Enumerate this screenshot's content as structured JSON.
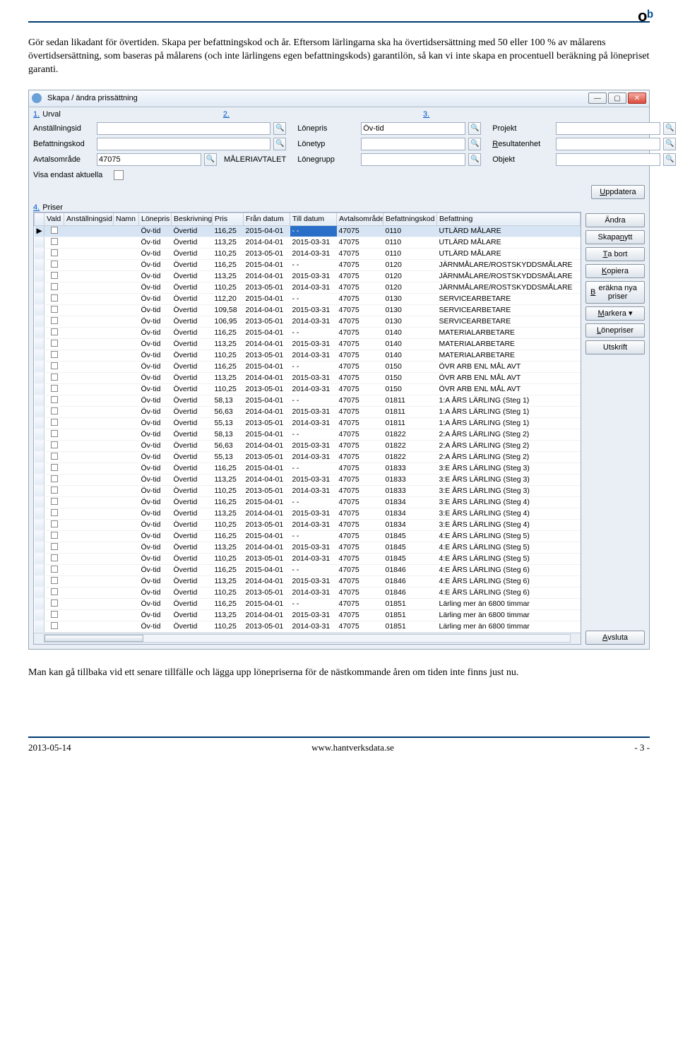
{
  "page": {
    "intro": "Gör sedan likadant för övertiden. Skapa per befattningskod och år. Eftersom lärlingarna ska ha övertidsersättning med 50 eller 100 % av målarens övertidsersättning, som baseras på målarens (och inte lärlingens egen befattningskods) garantilön, så kan vi inte skapa en procentuell beräkning på lönepriset garanti.",
    "outro": "Man kan gå tillbaka vid ett senare tillfälle och lägga upp lönepriserna för de nästkommande åren om tiden inte finns just nu.",
    "footer_left": "2013-05-14",
    "footer_center": "www.hantverksdata.se",
    "footer_right": "- 3 -"
  },
  "window": {
    "title": "Skapa / ändra prissättning",
    "sections": {
      "s1": "1.",
      "s1_label": "Urval",
      "s2": "2.",
      "s3": "3.",
      "s4": "4.",
      "s4_label": "Priser"
    }
  },
  "filters": {
    "anstallningsid": "Anställningsid",
    "befattningskod": "Befattningskod",
    "avtalsomrade": "Avtalsområde",
    "avtalsomrade_val": "47075",
    "avtalsomrade_text": "MÅLERIAVTALET",
    "visa_endast": "Visa endast aktuella",
    "lonepris": "Lönepris",
    "lonepris_val": "Öv-tid",
    "lonetyp": "Lönetyp",
    "lonegrupp": "Lönegrupp",
    "projekt": "Projekt",
    "resultatenhet": "Resultatenhet",
    "objekt": "Objekt"
  },
  "buttons": {
    "uppdatera": "Uppdatera",
    "andra": "Ändra",
    "skapa_nytt": "Skapa nytt",
    "ta_bort": "Ta bort",
    "kopiera": "Kopiera",
    "berakna": "Beräkna nya priser",
    "markera": "Markera",
    "lonepriser": "Lönepriser",
    "utskrift": "Utskrift",
    "avsluta": "Avsluta"
  },
  "columns": [
    "Vald",
    "Anställningsid",
    "Namn",
    "Lönepris",
    "Beskrivning",
    "Pris",
    "Från datum",
    "Till datum",
    "Avtalsområde",
    "Befattningskod",
    "Befattning"
  ],
  "rows": [
    {
      "lp": "Öv-tid",
      "besk": "Övertid",
      "pris": "116,25",
      "fran": "2015-04-01",
      "till": "- -",
      "avt": "47075",
      "bk": "0110",
      "bef": "UTLÄRD MÅLARE",
      "sel": true
    },
    {
      "lp": "Öv-tid",
      "besk": "Övertid",
      "pris": "113,25",
      "fran": "2014-04-01",
      "till": "2015-03-31",
      "avt": "47075",
      "bk": "0110",
      "bef": "UTLÄRD MÅLARE"
    },
    {
      "lp": "Öv-tid",
      "besk": "Övertid",
      "pris": "110,25",
      "fran": "2013-05-01",
      "till": "2014-03-31",
      "avt": "47075",
      "bk": "0110",
      "bef": "UTLÄRD MÅLARE"
    },
    {
      "lp": "Öv-tid",
      "besk": "Övertid",
      "pris": "116,25",
      "fran": "2015-04-01",
      "till": "- -",
      "avt": "47075",
      "bk": "0120",
      "bef": "JÄRNMÅLARE/ROSTSKYDDSMÅLARE"
    },
    {
      "lp": "Öv-tid",
      "besk": "Övertid",
      "pris": "113,25",
      "fran": "2014-04-01",
      "till": "2015-03-31",
      "avt": "47075",
      "bk": "0120",
      "bef": "JÄRNMÅLARE/ROSTSKYDDSMÅLARE"
    },
    {
      "lp": "Öv-tid",
      "besk": "Övertid",
      "pris": "110,25",
      "fran": "2013-05-01",
      "till": "2014-03-31",
      "avt": "47075",
      "bk": "0120",
      "bef": "JÄRNMÅLARE/ROSTSKYDDSMÅLARE"
    },
    {
      "lp": "Öv-tid",
      "besk": "Övertid",
      "pris": "112,20",
      "fran": "2015-04-01",
      "till": "- -",
      "avt": "47075",
      "bk": "0130",
      "bef": "SERVICEARBETARE"
    },
    {
      "lp": "Öv-tid",
      "besk": "Övertid",
      "pris": "109,58",
      "fran": "2014-04-01",
      "till": "2015-03-31",
      "avt": "47075",
      "bk": "0130",
      "bef": "SERVICEARBETARE"
    },
    {
      "lp": "Öv-tid",
      "besk": "Övertid",
      "pris": "106,95",
      "fran": "2013-05-01",
      "till": "2014-03-31",
      "avt": "47075",
      "bk": "0130",
      "bef": "SERVICEARBETARE"
    },
    {
      "lp": "Öv-tid",
      "besk": "Övertid",
      "pris": "116,25",
      "fran": "2015-04-01",
      "till": "- -",
      "avt": "47075",
      "bk": "0140",
      "bef": "MATERIALARBETARE"
    },
    {
      "lp": "Öv-tid",
      "besk": "Övertid",
      "pris": "113,25",
      "fran": "2014-04-01",
      "till": "2015-03-31",
      "avt": "47075",
      "bk": "0140",
      "bef": "MATERIALARBETARE"
    },
    {
      "lp": "Öv-tid",
      "besk": "Övertid",
      "pris": "110,25",
      "fran": "2013-05-01",
      "till": "2014-03-31",
      "avt": "47075",
      "bk": "0140",
      "bef": "MATERIALARBETARE"
    },
    {
      "lp": "Öv-tid",
      "besk": "Övertid",
      "pris": "116,25",
      "fran": "2015-04-01",
      "till": "- -",
      "avt": "47075",
      "bk": "0150",
      "bef": "ÖVR ARB ENL MÅL AVT"
    },
    {
      "lp": "Öv-tid",
      "besk": "Övertid",
      "pris": "113,25",
      "fran": "2014-04-01",
      "till": "2015-03-31",
      "avt": "47075",
      "bk": "0150",
      "bef": "ÖVR ARB ENL MÅL AVT"
    },
    {
      "lp": "Öv-tid",
      "besk": "Övertid",
      "pris": "110,25",
      "fran": "2013-05-01",
      "till": "2014-03-31",
      "avt": "47075",
      "bk": "0150",
      "bef": "ÖVR ARB ENL MÅL AVT"
    },
    {
      "lp": "Öv-tid",
      "besk": "Övertid",
      "pris": "58,13",
      "fran": "2015-04-01",
      "till": "- -",
      "avt": "47075",
      "bk": "01811",
      "bef": "1:A ÅRS LÄRLING (Steg 1)"
    },
    {
      "lp": "Öv-tid",
      "besk": "Övertid",
      "pris": "56,63",
      "fran": "2014-04-01",
      "till": "2015-03-31",
      "avt": "47075",
      "bk": "01811",
      "bef": "1:A ÅRS LÄRLING (Steg 1)"
    },
    {
      "lp": "Öv-tid",
      "besk": "Övertid",
      "pris": "55,13",
      "fran": "2013-05-01",
      "till": "2014-03-31",
      "avt": "47075",
      "bk": "01811",
      "bef": "1:A ÅRS LÄRLING (Steg 1)"
    },
    {
      "lp": "Öv-tid",
      "besk": "Övertid",
      "pris": "58,13",
      "fran": "2015-04-01",
      "till": "- -",
      "avt": "47075",
      "bk": "01822",
      "bef": "2:A ÅRS LÄRLING (Steg 2)"
    },
    {
      "lp": "Öv-tid",
      "besk": "Övertid",
      "pris": "56,63",
      "fran": "2014-04-01",
      "till": "2015-03-31",
      "avt": "47075",
      "bk": "01822",
      "bef": "2:A ÅRS LÄRLING (Steg 2)"
    },
    {
      "lp": "Öv-tid",
      "besk": "Övertid",
      "pris": "55,13",
      "fran": "2013-05-01",
      "till": "2014-03-31",
      "avt": "47075",
      "bk": "01822",
      "bef": "2:A ÅRS LÄRLING (Steg 2)"
    },
    {
      "lp": "Öv-tid",
      "besk": "Övertid",
      "pris": "116,25",
      "fran": "2015-04-01",
      "till": "- -",
      "avt": "47075",
      "bk": "01833",
      "bef": "3:E ÅRS LÄRLING (Steg 3)"
    },
    {
      "lp": "Öv-tid",
      "besk": "Övertid",
      "pris": "113,25",
      "fran": "2014-04-01",
      "till": "2015-03-31",
      "avt": "47075",
      "bk": "01833",
      "bef": "3:E ÅRS LÄRLING (Steg 3)"
    },
    {
      "lp": "Öv-tid",
      "besk": "Övertid",
      "pris": "110,25",
      "fran": "2013-05-01",
      "till": "2014-03-31",
      "avt": "47075",
      "bk": "01833",
      "bef": "3:E ÅRS LÄRLING (Steg 3)"
    },
    {
      "lp": "Öv-tid",
      "besk": "Övertid",
      "pris": "116,25",
      "fran": "2015-04-01",
      "till": "- -",
      "avt": "47075",
      "bk": "01834",
      "bef": "3:E ÅRS LÄRLING (Steg 4)"
    },
    {
      "lp": "Öv-tid",
      "besk": "Övertid",
      "pris": "113,25",
      "fran": "2014-04-01",
      "till": "2015-03-31",
      "avt": "47075",
      "bk": "01834",
      "bef": "3:E ÅRS LÄRLING (Steg 4)"
    },
    {
      "lp": "Öv-tid",
      "besk": "Övertid",
      "pris": "110,25",
      "fran": "2013-05-01",
      "till": "2014-03-31",
      "avt": "47075",
      "bk": "01834",
      "bef": "3:E ÅRS LÄRLING (Steg 4)"
    },
    {
      "lp": "Öv-tid",
      "besk": "Övertid",
      "pris": "116,25",
      "fran": "2015-04-01",
      "till": "- -",
      "avt": "47075",
      "bk": "01845",
      "bef": "4:E ÅRS LÄRLING (Steg 5)"
    },
    {
      "lp": "Öv-tid",
      "besk": "Övertid",
      "pris": "113,25",
      "fran": "2014-04-01",
      "till": "2015-03-31",
      "avt": "47075",
      "bk": "01845",
      "bef": "4:E ÅRS LÄRLING (Steg 5)"
    },
    {
      "lp": "Öv-tid",
      "besk": "Övertid",
      "pris": "110,25",
      "fran": "2013-05-01",
      "till": "2014-03-31",
      "avt": "47075",
      "bk": "01845",
      "bef": "4:E ÅRS LÄRLING (Steg 5)"
    },
    {
      "lp": "Öv-tid",
      "besk": "Övertid",
      "pris": "116,25",
      "fran": "2015-04-01",
      "till": "- -",
      "avt": "47075",
      "bk": "01846",
      "bef": "4:E ÅRS LÄRLING (Steg 6)"
    },
    {
      "lp": "Öv-tid",
      "besk": "Övertid",
      "pris": "113,25",
      "fran": "2014-04-01",
      "till": "2015-03-31",
      "avt": "47075",
      "bk": "01846",
      "bef": "4:E ÅRS LÄRLING (Steg 6)"
    },
    {
      "lp": "Öv-tid",
      "besk": "Övertid",
      "pris": "110,25",
      "fran": "2013-05-01",
      "till": "2014-03-31",
      "avt": "47075",
      "bk": "01846",
      "bef": "4:E ÅRS LÄRLING (Steg 6)"
    },
    {
      "lp": "Öv-tid",
      "besk": "Övertid",
      "pris": "116,25",
      "fran": "2015-04-01",
      "till": "- -",
      "avt": "47075",
      "bk": "01851",
      "bef": "Lärling mer än 6800 timmar"
    },
    {
      "lp": "Öv-tid",
      "besk": "Övertid",
      "pris": "113,25",
      "fran": "2014-04-01",
      "till": "2015-03-31",
      "avt": "47075",
      "bk": "01851",
      "bef": "Lärling mer än 6800 timmar"
    },
    {
      "lp": "Öv-tid",
      "besk": "Övertid",
      "pris": "110,25",
      "fran": "2013-05-01",
      "till": "2014-03-31",
      "avt": "47075",
      "bk": "01851",
      "bef": "Lärling mer än 6800 timmar"
    }
  ]
}
